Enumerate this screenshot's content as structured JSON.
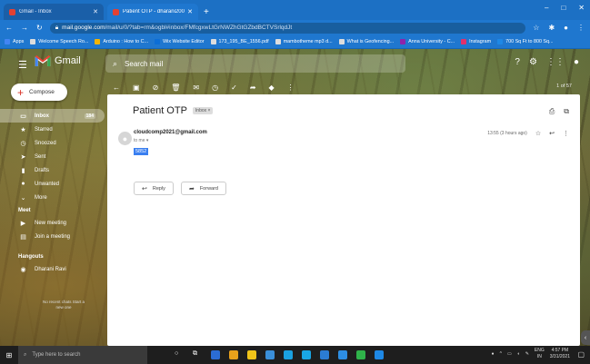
{
  "browser": {
    "tabs": [
      {
        "title": "Gmail - Inbox",
        "active": false
      },
      {
        "title": "Patient OTP - dharani2000@g...",
        "active": true
      }
    ],
    "new_tab": "+",
    "window_controls": [
      "–",
      "□",
      "✕"
    ],
    "url_host": "mail.google.com",
    "url_path": "/mail/u/0/?tab=rm&ogbl#inbox/FMfcgxwLtGrNWZhGtGZbdBCTVSrlqdJt",
    "bookmarks": [
      "Apps",
      "Welcome Speech Ro...",
      "Arduino : How to C...",
      "Wix Website Editor",
      "173_195_BE_1556.pdf",
      "mambotheme mp3 d...",
      "What is Geofencing...",
      "Anna University - C...",
      "Instagram",
      "700 Sq Ft to 800 Sq..."
    ]
  },
  "gmail": {
    "brand": "Gmail",
    "search_placeholder": "Search mail",
    "pagination": "1 of 57",
    "compose_label": "Compose",
    "nav": [
      {
        "label": "Inbox",
        "icon": "inbox-icon",
        "count": "184",
        "active": true
      },
      {
        "label": "Starred",
        "icon": "star-icon"
      },
      {
        "label": "Snoozed",
        "icon": "clock-icon"
      },
      {
        "label": "Sent",
        "icon": "send-icon"
      },
      {
        "label": "Drafts",
        "icon": "draft-icon"
      },
      {
        "label": "Unwanted",
        "icon": "label-icon"
      },
      {
        "label": "More",
        "icon": "chevron-down-icon"
      }
    ],
    "meet_heading": "Meet",
    "meet_new": "New meeting",
    "meet_join": "Join a meeting",
    "hangouts_heading": "Hangouts",
    "hangouts_user": "Dharani Ravi",
    "hangouts_note": "No recent chats Start a new one"
  },
  "message": {
    "subject": "Patient OTP",
    "label": "Inbox ×",
    "sender": "cloudcomp2021@gmail.com",
    "to": "to me ▾",
    "body_selected": "5852",
    "time": "13:55 (3 hours ago)",
    "reply_label": "Reply",
    "forward_label": "Forward"
  },
  "taskbar": {
    "search_placeholder": "Type here to search",
    "lang": "ENG",
    "lang_sub": "IN",
    "time": "4:57 PM",
    "date": "3/31/2021"
  }
}
